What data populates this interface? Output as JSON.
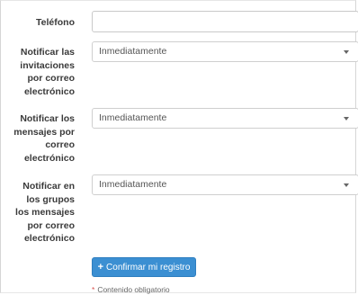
{
  "form": {
    "telefono": {
      "label": "Teléfono",
      "value": ""
    },
    "notificar_invitaciones": {
      "label_lines": [
        "Notificar las",
        "invitaciones",
        "por correo",
        "electrónico"
      ],
      "value": "Inmediatamente"
    },
    "notificar_mensajes": {
      "label_lines": [
        "Notificar los",
        "mensajes por",
        "correo",
        "electrónico"
      ],
      "value": "Inmediatamente"
    },
    "notificar_grupos": {
      "label_lines": [
        "Notificar en",
        "los grupos",
        "los mensajes",
        "por correo",
        "electrónico"
      ],
      "value": "Inmediatamente"
    },
    "submit_label": "Confirmar mi registro",
    "required_note": "Contenido obligatorio"
  },
  "icons": {
    "submit": "plus-icon",
    "select": "caret-down-icon",
    "required": "asterisk-icon"
  },
  "colors": {
    "primary": "#3b8fd2",
    "required": "#d9534f",
    "label": "#3a3a3a"
  }
}
